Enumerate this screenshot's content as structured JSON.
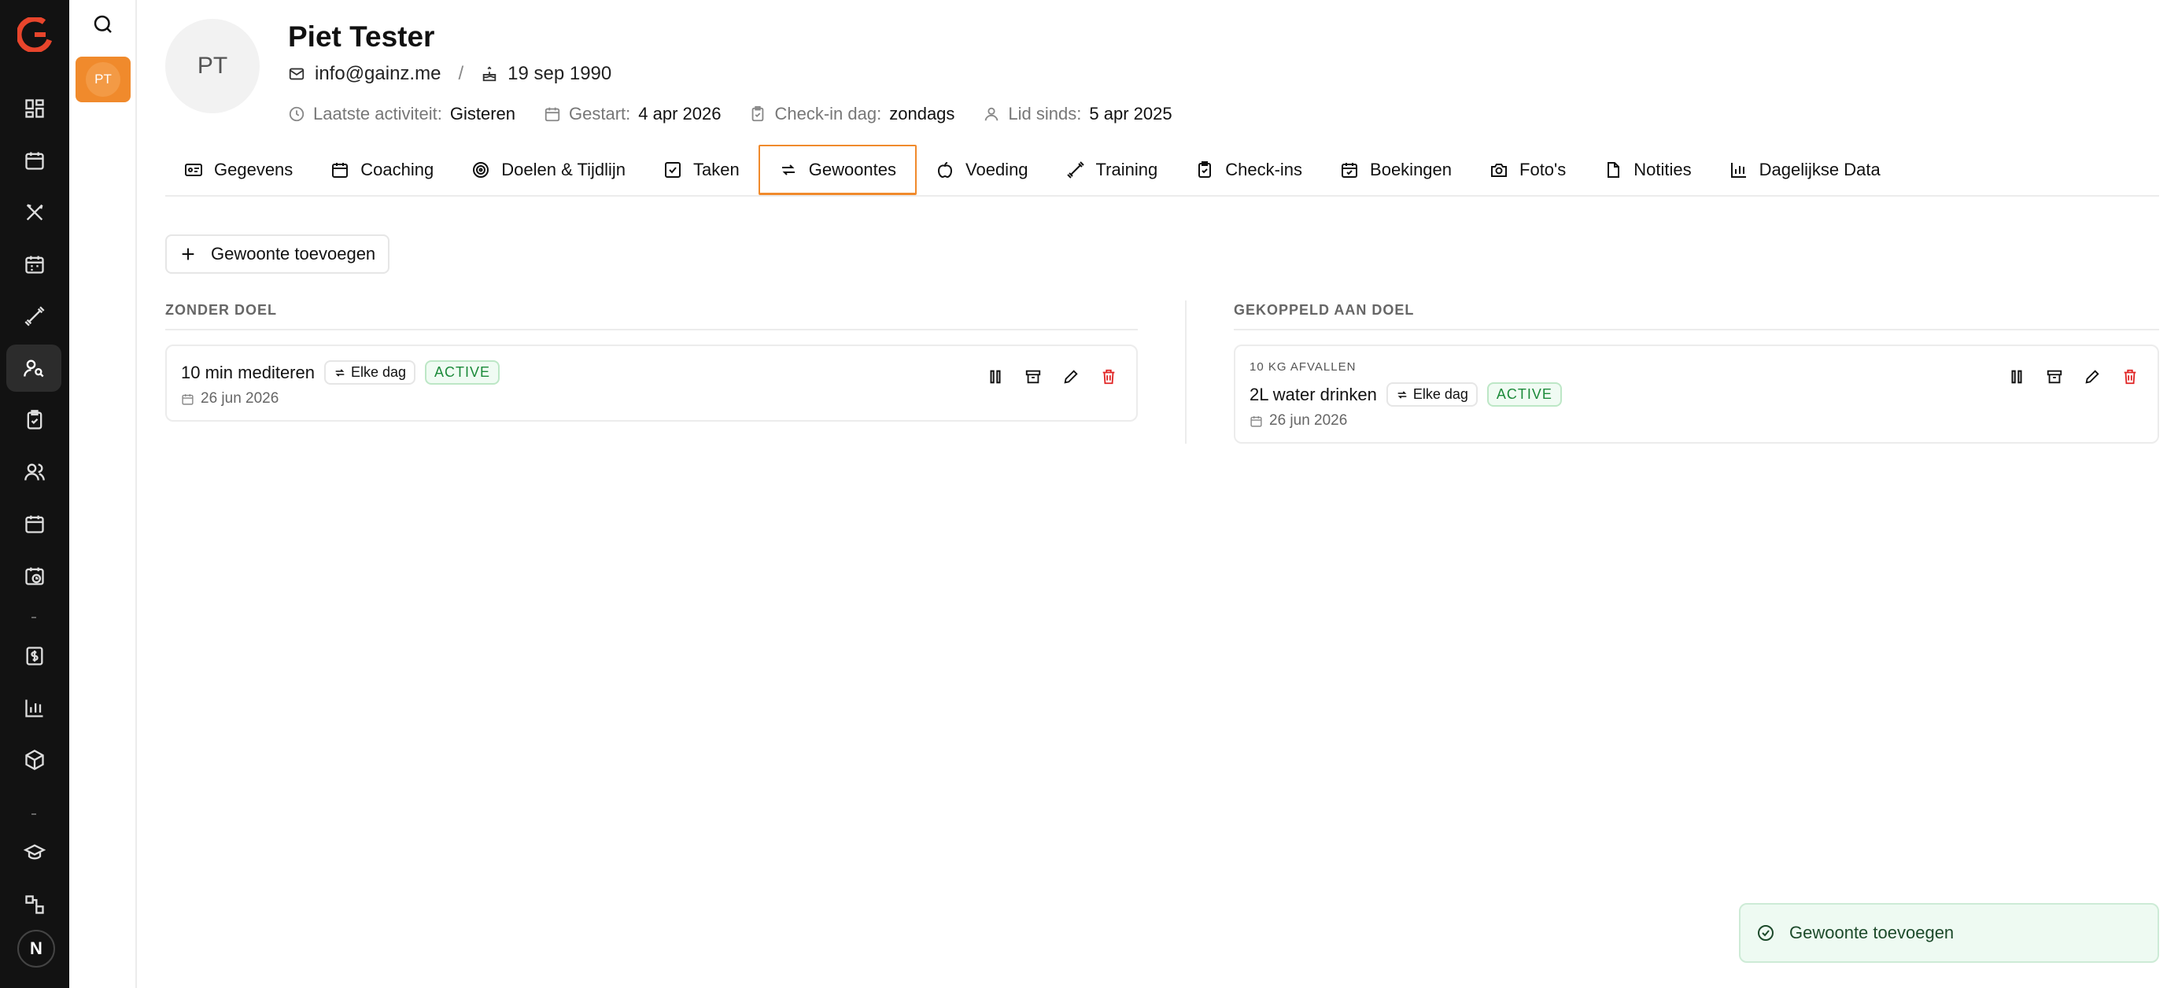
{
  "client": {
    "initials": "PT",
    "name": "Piet Tester",
    "email": "info@gainz.me",
    "birthday": "19 sep 1990",
    "last_activity_label": "Laatste activiteit:",
    "last_activity_value": "Gisteren",
    "started_label": "Gestart:",
    "started_value": "4 apr 2026",
    "checkin_label": "Check-in dag:",
    "checkin_value": "zondags",
    "member_label": "Lid sinds:",
    "member_value": "5 apr 2025"
  },
  "tabs": [
    {
      "label": "Gegevens",
      "icon": "id-card-icon"
    },
    {
      "label": "Coaching",
      "icon": "calendar-icon"
    },
    {
      "label": "Doelen & Tijdlijn",
      "icon": "target-icon"
    },
    {
      "label": "Taken",
      "icon": "checkbox-icon"
    },
    {
      "label": "Gewoontes",
      "icon": "repeat-icon",
      "active": true
    },
    {
      "label": "Voeding",
      "icon": "apple-icon"
    },
    {
      "label": "Training",
      "icon": "dumbbell-icon"
    },
    {
      "label": "Check-ins",
      "icon": "clipboard-icon"
    },
    {
      "label": "Boekingen",
      "icon": "calendar-check-icon"
    },
    {
      "label": "Foto's",
      "icon": "camera-icon"
    },
    {
      "label": "Notities",
      "icon": "file-icon"
    },
    {
      "label": "Dagelijkse Data",
      "icon": "bar-chart-icon"
    }
  ],
  "add_habit_label": "Gewoonte toevoegen",
  "columns": {
    "without_goal": {
      "title": "ZONDER DOEL",
      "habits": [
        {
          "name": "10 min mediteren",
          "frequency": "Elke dag",
          "status": "ACTIVE",
          "date": "26 jun 2026"
        }
      ]
    },
    "with_goal": {
      "title": "GEKOPPELD AAN DOEL",
      "habits": [
        {
          "goal": "10 KG AFVALLEN",
          "name": "2L water drinken",
          "frequency": "Elke dag",
          "status": "ACTIVE",
          "date": "26 jun 2026"
        }
      ]
    }
  },
  "toast": {
    "message": "Gewoonte toevoegen"
  },
  "rail": {
    "bottom_badge": "N"
  },
  "colors": {
    "accent": "#f08a2c",
    "rail": "#121212",
    "success": "#1c8a3a",
    "danger": "#e02424"
  }
}
